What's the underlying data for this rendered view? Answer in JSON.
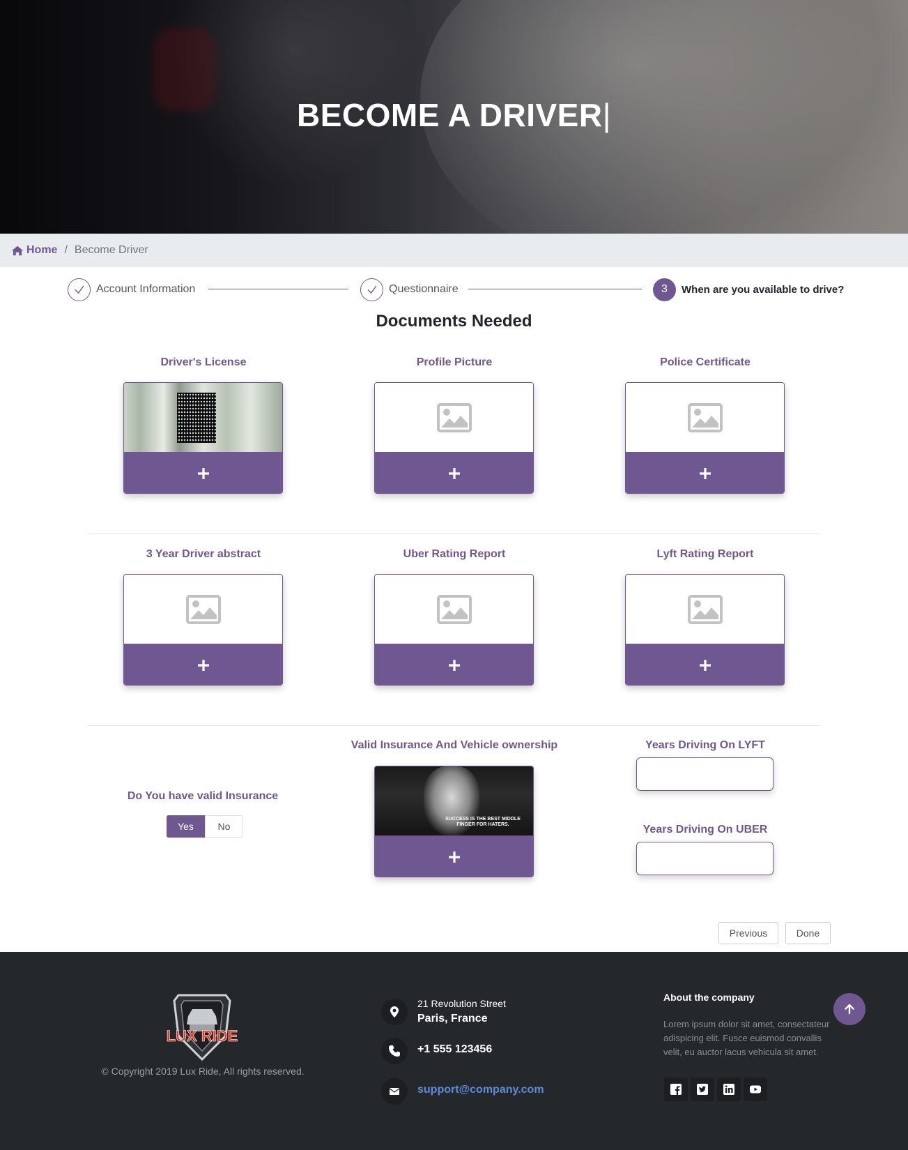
{
  "hero": {
    "title": "BECOME A DRIVER",
    "caret": "|"
  },
  "breadcrumb": {
    "home": "Home",
    "separator": "/",
    "current": "Become Driver"
  },
  "stepper": {
    "steps": [
      {
        "label": "Account Information",
        "state": "done"
      },
      {
        "label": "Questionnaire",
        "state": "done"
      },
      {
        "number": "3",
        "label": "When are you available to drive?",
        "state": "active"
      }
    ]
  },
  "documents": {
    "title": "Documents Needed",
    "cards": [
      {
        "label": "Driver's License",
        "preview": "license-photo"
      },
      {
        "label": "Profile Picture",
        "preview": "image-placeholder"
      },
      {
        "label": "Police Certificate",
        "preview": "image-placeholder"
      },
      {
        "label": "3 Year Driver abstract",
        "preview": "image-placeholder"
      },
      {
        "label": "Uber Rating Report",
        "preview": "image-placeholder"
      },
      {
        "label": "Lyft Rating Report",
        "preview": "image-placeholder"
      },
      {
        "label": "Valid Insurance And Vehicle ownership",
        "preview": "uploaded-photo",
        "preview_text": "SUCCESS IS THE BEST MIDDLE FINGER FOR HATERS."
      }
    ],
    "add_icon": "plus-icon"
  },
  "insurance": {
    "question": "Do You have valid Insurance",
    "options": [
      "Yes",
      "No"
    ],
    "selected": "Yes"
  },
  "years": {
    "lyft_label": "Years Driving On LYFT",
    "lyft_value": "",
    "uber_label": "Years Driving On UBER",
    "uber_value": ""
  },
  "nav": {
    "previous": "Previous",
    "done": "Done"
  },
  "footer": {
    "logo_text": "LUX RIDE",
    "copyright": "© Copyright 2019 Lux Ride, All rights reserved.",
    "address_line1": "21 Revolution Street",
    "address_line2": "Paris, France",
    "phone": "+1 555 123456",
    "email": "support@company.com",
    "about_heading": "About the company",
    "about_text": "Lorem ipsum dolor sit amet, consectateur adispicing elit. Fusce euismod convallis velit, eu auctor lacus vehicula sit amet.",
    "social": [
      "facebook-icon",
      "twitter-icon",
      "linkedin-icon",
      "youtube-icon"
    ]
  },
  "colors": {
    "accent": "#6f5891",
    "footer_bg": "#25282b",
    "link": "#5b8cdc"
  }
}
